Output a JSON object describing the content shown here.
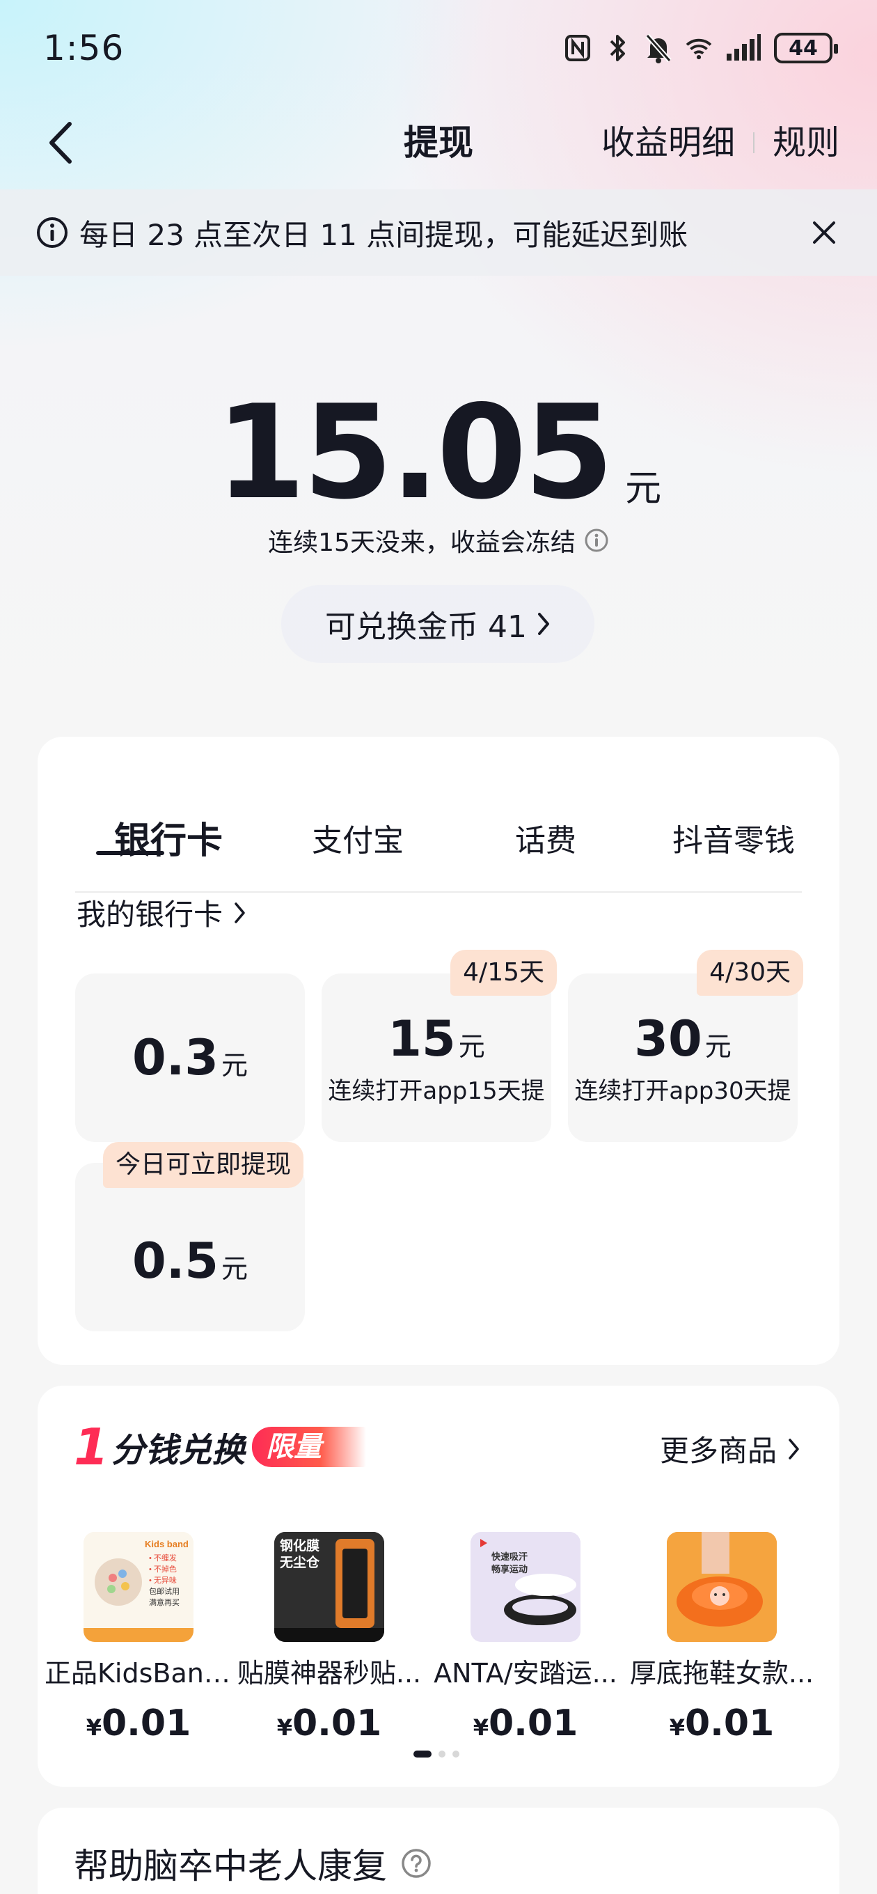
{
  "status_bar": {
    "time": "1:56",
    "battery": "44",
    "icons": [
      "nfc-icon",
      "bluetooth-icon",
      "mute-bell-icon",
      "wifi-icon",
      "signal-icon",
      "battery-icon"
    ]
  },
  "nav": {
    "title": "提现",
    "earnings_detail": "收益明细",
    "rules": "规则"
  },
  "notice": {
    "text": "每日 23 点至次日 11 点间提现，可能延迟到账"
  },
  "balance": {
    "amount": "15.05",
    "unit": "元",
    "freeze_warning": "连续15天没来，收益会冻结",
    "coin_exchange": "可兑换金币 41"
  },
  "withdraw": {
    "tabs": [
      {
        "label": "银行卡",
        "active": true
      },
      {
        "label": "支付宝",
        "active": false
      },
      {
        "label": "话费",
        "active": false
      },
      {
        "label": "抖音零钱",
        "active": false
      }
    ],
    "my_bank_card": "我的银行卡",
    "options": [
      {
        "amount": "0.3",
        "unit": "元",
        "desc": "",
        "badge": ""
      },
      {
        "amount": "15",
        "unit": "元",
        "desc": "连续打开app15天提",
        "badge": "4/15天"
      },
      {
        "amount": "30",
        "unit": "元",
        "desc": "连续打开app30天提",
        "badge": "4/30天"
      },
      {
        "amount": "0.5",
        "unit": "元",
        "desc": "",
        "badge": "今日可立即提现"
      }
    ]
  },
  "deals": {
    "title_number": "1",
    "title_text": "分钱兑换",
    "tag": "限量",
    "more": "更多商品",
    "items": [
      {
        "name": "正品KidsBand...",
        "yen": "¥",
        "price": "0.01"
      },
      {
        "name": "贴膜神器秒贴...",
        "yen": "¥",
        "price": "0.01"
      },
      {
        "name": "ANTA/安踏运...",
        "yen": "¥",
        "price": "0.01"
      },
      {
        "name": "厚底拖鞋女款...",
        "yen": "¥",
        "price": "0.01"
      }
    ],
    "item_images": {
      "item0_brand": "Kids band",
      "item0_lines": [
        "• 不缠发",
        "• 不掉色",
        "• 无异味",
        "包邮试用",
        "满意再买"
      ],
      "item1_title": [
        "钢化膜",
        "无尘仓"
      ],
      "item2_text": [
        "快速吸汗",
        "畅享运动"
      ]
    },
    "colors": {
      "accent": "#fe2c55"
    }
  },
  "bottom_card": {
    "title": "帮助脑卒中老人康复"
  }
}
